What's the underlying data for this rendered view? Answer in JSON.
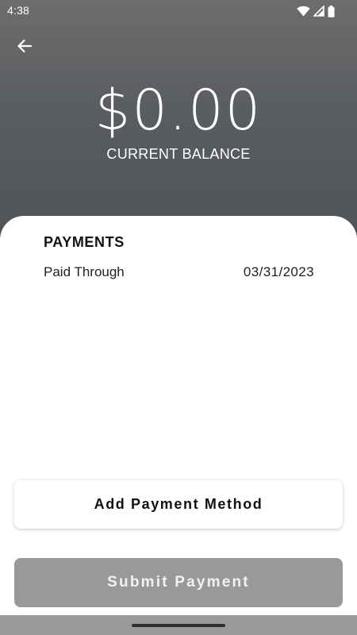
{
  "status_bar": {
    "time": "4:38",
    "icons": [
      "wifi-icon",
      "cellular-signal-icon",
      "battery-icon"
    ]
  },
  "header": {
    "back_icon": "arrow-left-icon",
    "balance_amount": "$0.00",
    "balance_label": "CURRENT BALANCE"
  },
  "payments": {
    "title": "PAYMENTS",
    "paid_through_label": "Paid Through",
    "paid_through_value": "03/31/2023"
  },
  "actions": {
    "add_method_label": "Add Payment Method",
    "submit_label": "Submit Payment",
    "submit_enabled": false
  },
  "colors": {
    "header_gradient_top": "#6d6d6d",
    "header_gradient_bottom": "#4f5459",
    "submit_disabled_bg": "#999999",
    "nav_bar_bg": "#9a9a9a"
  }
}
